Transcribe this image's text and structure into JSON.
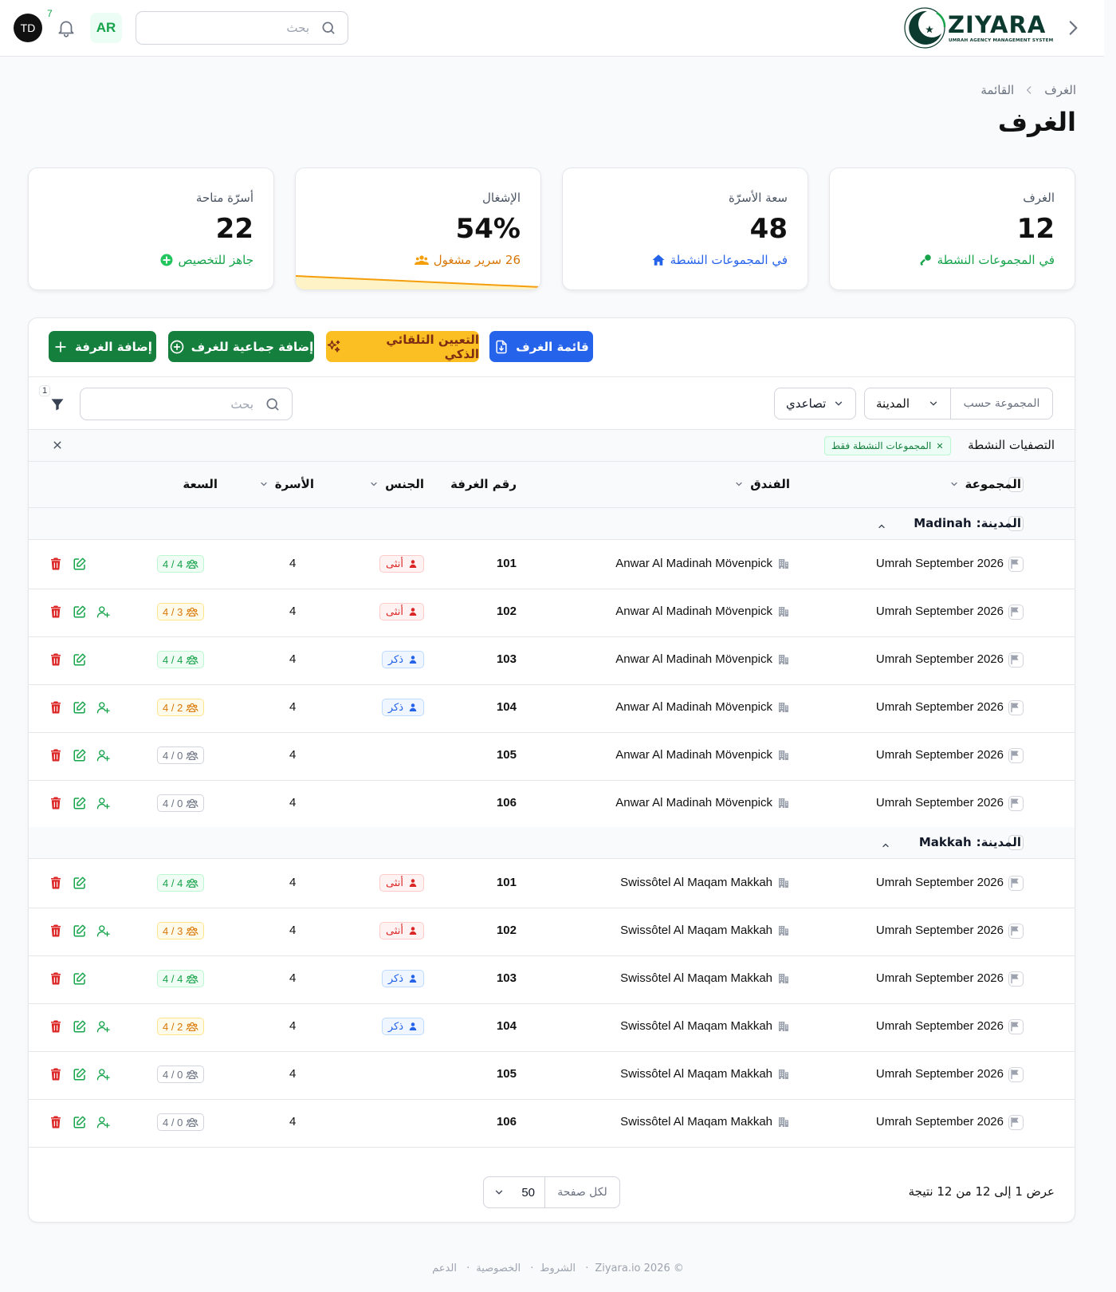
{
  "header": {
    "logo_text": "ZIYARA",
    "logo_subtitle": "UMRAH AGENCY MANAGEMENT SYSTEM",
    "search_placeholder": "بحث",
    "language": "AR",
    "notifications_count": "7",
    "user_initials": "TD"
  },
  "breadcrumb": {
    "items": [
      "الغرف",
      "القائمة"
    ]
  },
  "page_title": "الغرف",
  "stats": [
    {
      "label": "الغرف",
      "value": "12",
      "sub": "في المجموعات النشطة",
      "color": "#16a34a",
      "icon": "key-icon"
    },
    {
      "label": "سعة الأسرّة",
      "value": "48",
      "sub": "في المجموعات النشطة",
      "color": "#2563eb",
      "icon": "home-icon"
    },
    {
      "label": "الإشغال",
      "value": "54%",
      "sub": "26 سرير مشغول",
      "color": "#f59e0b",
      "icon": "users-icon",
      "progress": 0.54
    },
    {
      "label": "أسرّة متاحة",
      "value": "22",
      "sub": "جاهز للتخصيص",
      "color": "#16a34a",
      "icon": "plus-circle-icon"
    }
  ],
  "toolbar": {
    "add_room": "إضافة الغرفة",
    "bulk_add": "إضافة جماعية للغرف",
    "smart_assign": "التعيين التلقائي الذكي",
    "room_list": "قائمة الغرف"
  },
  "filters": {
    "group_by_label": "المجموعة حسب",
    "group_by_value": "المدينة",
    "sort_value": "تصاعدي",
    "search_placeholder": "بحث",
    "filter_count": "1",
    "active_label": "التصفيات النشطة",
    "active_chip": "المجموعات النشطة فقط"
  },
  "columns": {
    "group": "المجموعة",
    "hotel": "الفندق",
    "room_number": "رقم الغرفة",
    "gender": "الجنس",
    "beds": "الأسرة",
    "capacity": "السعة"
  },
  "groups": [
    {
      "prefix": "المدينة:",
      "city": "Madinah",
      "rows": [
        {
          "group": "Umrah September 2026",
          "hotel": "Anwar Al Madinah Mövenpick",
          "room": "101",
          "gender": "أنثى",
          "gender_type": "female",
          "beds": "4",
          "capacity": "4 / 4",
          "cap_state": "full",
          "assign": false
        },
        {
          "group": "Umrah September 2026",
          "hotel": "Anwar Al Madinah Mövenpick",
          "room": "102",
          "gender": "أنثى",
          "gender_type": "female",
          "beds": "4",
          "capacity": "4 / 3",
          "cap_state": "partial",
          "assign": true
        },
        {
          "group": "Umrah September 2026",
          "hotel": "Anwar Al Madinah Mövenpick",
          "room": "103",
          "gender": "ذكر",
          "gender_type": "male",
          "beds": "4",
          "capacity": "4 / 4",
          "cap_state": "full",
          "assign": false
        },
        {
          "group": "Umrah September 2026",
          "hotel": "Anwar Al Madinah Mövenpick",
          "room": "104",
          "gender": "ذكر",
          "gender_type": "male",
          "beds": "4",
          "capacity": "4 / 2",
          "cap_state": "partial",
          "assign": true
        },
        {
          "group": "Umrah September 2026",
          "hotel": "Anwar Al Madinah Mövenpick",
          "room": "105",
          "gender": "",
          "gender_type": "none",
          "beds": "4",
          "capacity": "4 / 0",
          "cap_state": "empty",
          "assign": true
        },
        {
          "group": "Umrah September 2026",
          "hotel": "Anwar Al Madinah Mövenpick",
          "room": "106",
          "gender": "",
          "gender_type": "none",
          "beds": "4",
          "capacity": "4 / 0",
          "cap_state": "empty",
          "assign": true
        }
      ]
    },
    {
      "prefix": "المدينة:",
      "city": "Makkah",
      "rows": [
        {
          "group": "Umrah September 2026",
          "hotel": "Swissôtel Al Maqam Makkah",
          "room": "101",
          "gender": "أنثى",
          "gender_type": "female",
          "beds": "4",
          "capacity": "4 / 4",
          "cap_state": "full",
          "assign": false
        },
        {
          "group": "Umrah September 2026",
          "hotel": "Swissôtel Al Maqam Makkah",
          "room": "102",
          "gender": "أنثى",
          "gender_type": "female",
          "beds": "4",
          "capacity": "4 / 3",
          "cap_state": "partial",
          "assign": true
        },
        {
          "group": "Umrah September 2026",
          "hotel": "Swissôtel Al Maqam Makkah",
          "room": "103",
          "gender": "ذكر",
          "gender_type": "male",
          "beds": "4",
          "capacity": "4 / 4",
          "cap_state": "full",
          "assign": false
        },
        {
          "group": "Umrah September 2026",
          "hotel": "Swissôtel Al Maqam Makkah",
          "room": "104",
          "gender": "ذكر",
          "gender_type": "male",
          "beds": "4",
          "capacity": "4 / 2",
          "cap_state": "partial",
          "assign": true
        },
        {
          "group": "Umrah September 2026",
          "hotel": "Swissôtel Al Maqam Makkah",
          "room": "105",
          "gender": "",
          "gender_type": "none",
          "beds": "4",
          "capacity": "4 / 0",
          "cap_state": "empty",
          "assign": true
        },
        {
          "group": "Umrah September 2026",
          "hotel": "Swissôtel Al Maqam Makkah",
          "room": "106",
          "gender": "",
          "gender_type": "none",
          "beds": "4",
          "capacity": "4 / 0",
          "cap_state": "empty",
          "assign": true
        }
      ]
    }
  ],
  "pagination": {
    "info": "عرض 1 إلى 12 من 12 نتيجة",
    "per_page_label": "لكل صفحة",
    "per_page_value": "50"
  },
  "footer": {
    "copyright": "© Ziyara.io 2026",
    "links": [
      "الشروط",
      "الخصوصية",
      "الدعم"
    ]
  }
}
